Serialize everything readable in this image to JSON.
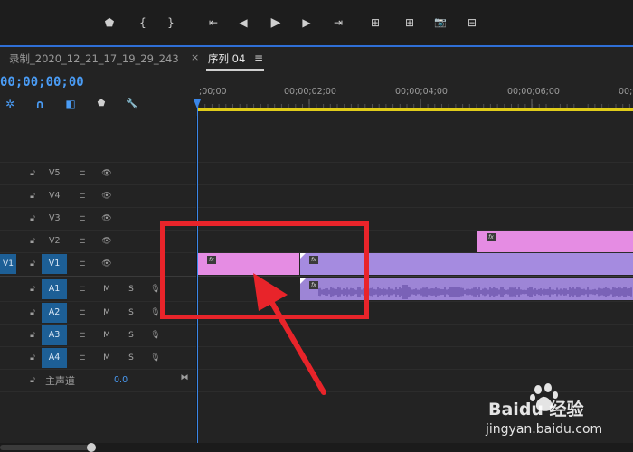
{
  "toolbar": {
    "buttons": [
      {
        "icon": "add-marker-icon",
        "glyph": "⬟"
      },
      {
        "icon": "mark-in-icon",
        "glyph": "{"
      },
      {
        "icon": "mark-out-icon",
        "glyph": "}"
      },
      {
        "icon": "go-to-in-icon",
        "glyph": "⇤"
      },
      {
        "icon": "step-back-icon",
        "glyph": "◀"
      },
      {
        "icon": "play-icon",
        "glyph": "▶"
      },
      {
        "icon": "step-forward-icon",
        "glyph": "▶"
      },
      {
        "icon": "go-to-out-icon",
        "glyph": "⇥"
      },
      {
        "icon": "lift-icon",
        "glyph": "⊞"
      },
      {
        "icon": "extract-icon",
        "glyph": "⊞"
      },
      {
        "icon": "export-frame-icon",
        "glyph": "📷"
      },
      {
        "icon": "insert-icon",
        "glyph": "⊟"
      }
    ]
  },
  "tabs": {
    "recording": "录制_2020_12_21_17_19_29_243",
    "sequence": "序列 04",
    "close_glyph": "×",
    "menu_glyph": "≡"
  },
  "timeline": {
    "timecode": "00;00;00;00",
    "ruler_labels": [
      ";00;00",
      "00;00;02;00",
      "00;00;04;00",
      "00;00;06;00",
      "00;0"
    ]
  },
  "tools": [
    {
      "icon": "snap-icon",
      "glyph": "✲"
    },
    {
      "icon": "linked-selection-icon",
      "glyph": "∩"
    },
    {
      "icon": "add-edit-icon",
      "glyph": "◧"
    },
    {
      "icon": "marker-icon",
      "glyph": "⬟"
    },
    {
      "icon": "settings-wrench-icon",
      "glyph": "🔧"
    }
  ],
  "video_tracks": [
    {
      "name": "V5"
    },
    {
      "name": "V4"
    },
    {
      "name": "V3"
    },
    {
      "name": "V2"
    },
    {
      "name": "V1",
      "source": "V1"
    }
  ],
  "audio_tracks": [
    {
      "name": "A1",
      "mute": "M",
      "solo": "S"
    },
    {
      "name": "A2",
      "mute": "M",
      "solo": "S"
    },
    {
      "name": "A3",
      "mute": "M",
      "solo": "S"
    },
    {
      "name": "A4",
      "mute": "M",
      "solo": "S"
    }
  ],
  "master": {
    "label": "主声道",
    "value": "0.0"
  },
  "clips": {
    "fx_label": "fx",
    "colors": {
      "pink": "#e58ce3",
      "purple": "#a58be0",
      "audio": "#9d85d6",
      "waveform": "#6f56ad"
    }
  },
  "watermark": {
    "brand": "Baidu 经验",
    "url": "jingyan.baidu.com"
  },
  "colors": {
    "accent": "#2f6fd6",
    "timecode": "#4a9cf5",
    "playhead": "#3a86e8",
    "work_area": "#e0cc1a",
    "highlight": "#e8242a"
  }
}
